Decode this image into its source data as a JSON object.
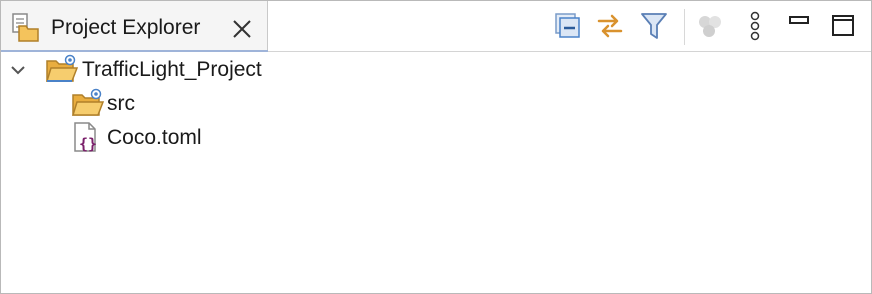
{
  "view": {
    "tab_label": "Project Explorer",
    "tab_icon": "project-explorer-icon",
    "close_icon": "close-icon"
  },
  "toolbar": {
    "buttons": [
      {
        "name": "collapse-all-button",
        "icon": "collapse-all-icon",
        "enabled": true
      },
      {
        "name": "link-with-editor-button",
        "icon": "link-with-editor-icon",
        "enabled": true
      },
      {
        "name": "filter-button",
        "icon": "filter-icon",
        "enabled": true
      },
      {
        "name": "focus-button",
        "icon": "focus-icon",
        "enabled": false
      },
      {
        "name": "view-menu-button",
        "icon": "kebab-menu-icon",
        "enabled": true
      },
      {
        "name": "minimize-button",
        "icon": "minimize-icon",
        "enabled": true
      },
      {
        "name": "maximize-button",
        "icon": "maximize-icon",
        "enabled": true
      }
    ]
  },
  "tree": {
    "project": {
      "label": "TrafficLight_Project",
      "expanded": true,
      "icon": "project-folder-icon",
      "children": [
        {
          "label": "src",
          "icon": "source-folder-icon"
        },
        {
          "label": "Coco.toml",
          "icon": "toml-file-icon"
        }
      ]
    }
  },
  "colors": {
    "folder": "#f4c35c",
    "folder_outline": "#b0802a",
    "accent_blue": "#4a82c8",
    "link_orange": "#d9922e",
    "brace_purple": "#7a1f6a",
    "tab_underline": "#9fb4d9",
    "disabled_gray": "#d7d7d7"
  }
}
